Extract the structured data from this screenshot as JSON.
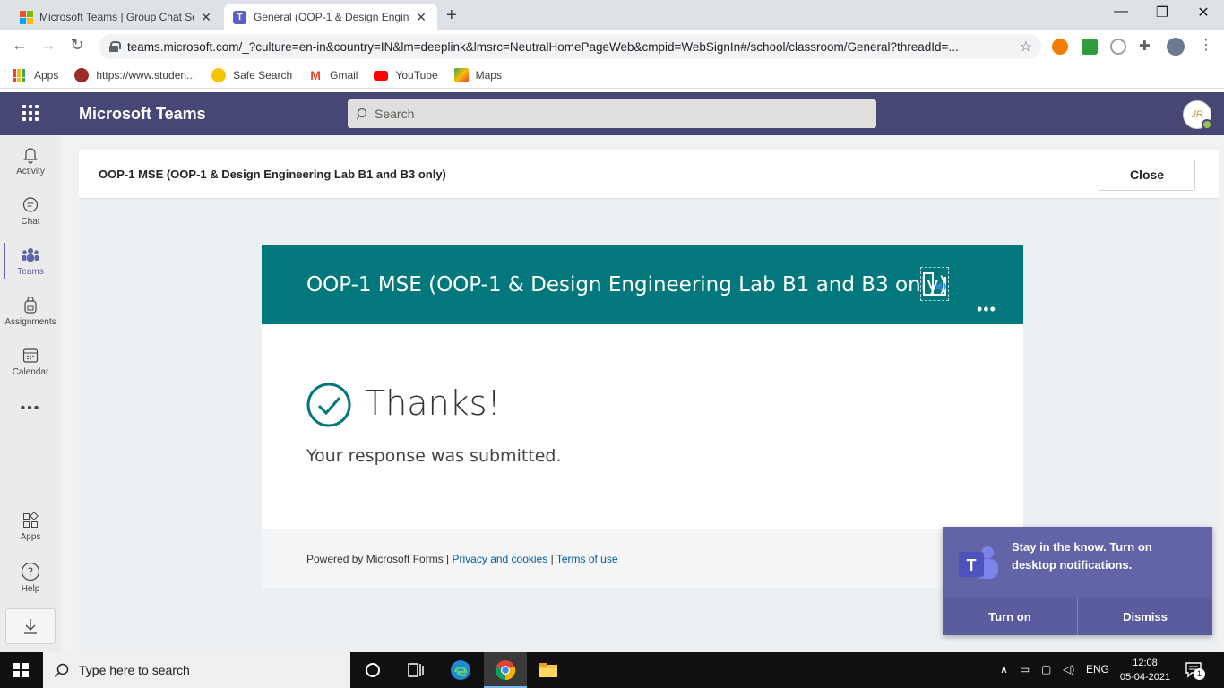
{
  "browser": {
    "tabs": [
      {
        "title": "Microsoft Teams | Group Chat So",
        "active": false
      },
      {
        "title": "General (OOP-1 & Design Engine",
        "active": true
      }
    ],
    "url": "teams.microsoft.com/_?culture=en-in&country=IN&lm=deeplink&lmsrc=NeutralHomePageWeb&cmpid=WebSignIn#/school/classroom/General?threadId=...",
    "bookmarks": [
      {
        "label": "Apps",
        "icon": "apps-grid-icon"
      },
      {
        "label": "https://www.studen...",
        "icon": "student-site-icon"
      },
      {
        "label": "Safe Search",
        "icon": "safe-search-icon"
      },
      {
        "label": "Gmail",
        "icon": "gmail-icon"
      },
      {
        "label": "YouTube",
        "icon": "youtube-icon"
      },
      {
        "label": "Maps",
        "icon": "maps-icon"
      }
    ]
  },
  "teams": {
    "app_title": "Microsoft Teams",
    "search_placeholder": "Search",
    "avatar_initials": "JR",
    "rail": [
      {
        "label": "Activity",
        "icon": "bell-icon"
      },
      {
        "label": "Chat",
        "icon": "chat-icon"
      },
      {
        "label": "Teams",
        "icon": "teams-icon",
        "active": true
      },
      {
        "label": "Assignments",
        "icon": "backpack-icon"
      },
      {
        "label": "Calendar",
        "icon": "calendar-icon"
      },
      {
        "label": "Apps",
        "icon": "apps-icon"
      },
      {
        "label": "Help",
        "icon": "help-icon"
      }
    ],
    "pane_title": "OOP-1 MSE (OOP-1 & Design Engineering Lab B1 and B3 only)",
    "close_label": "Close"
  },
  "form": {
    "title": "OOP-1 MSE (OOP-1 & Design Engineering Lab B1 and B3 only)",
    "thanks": "Thanks!",
    "message": "Your response was submitted.",
    "footer_prefix": "Powered by Microsoft Forms |",
    "privacy_link": "Privacy and cookies",
    "separator": "|",
    "terms_link": "Terms of use",
    "banner_color": "#03787c"
  },
  "toast": {
    "message": "Stay in the know. Turn on desktop notifications.",
    "turn_on": "Turn on",
    "dismiss": "Dismiss"
  },
  "taskbar": {
    "search_placeholder": "Type here to search",
    "language": "ENG",
    "time": "12:08",
    "date": "05-04-2021",
    "notification_count": "1"
  }
}
